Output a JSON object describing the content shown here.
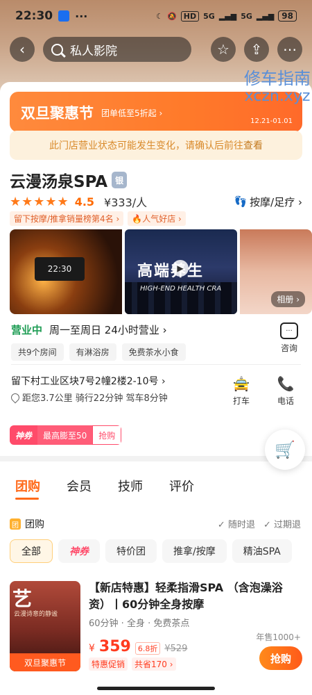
{
  "status_bar": {
    "time": "22:30",
    "dots": "···",
    "net_chip": "HD",
    "signal1": "5G",
    "signal2": "5G",
    "battery": "98"
  },
  "nav": {
    "back_icon": "back-arrow-icon",
    "search_text": "私人影院",
    "star_icon": "star-icon",
    "share_icon": "share-icon",
    "more_icon": "more-icon"
  },
  "watermark": {
    "line1": "修车指南",
    "line2": "xczn.xyz"
  },
  "promo": {
    "title": "双旦聚惠节",
    "subtitle": "团单低至5折起 ›",
    "dates": "12.21-01.01"
  },
  "notice": {
    "text": "此门店营业状态可能发生变化，请确认后前往",
    "link": "查看"
  },
  "store": {
    "name": "云漫汤泉SPA",
    "badge": "银",
    "stars": "★★★★★",
    "rating": "4.5",
    "price": "¥333/人",
    "category": "按摩/足疗 ›",
    "rank_tag": "留下按摩/推拿销量榜第4名 ›",
    "hot_tag": "🔥人气好店 ›"
  },
  "gallery": {
    "clock_text": "22:30",
    "video_title": "高端养生",
    "video_sub": "HIGH-END HEALTH CRA",
    "album_label": "相册 ›"
  },
  "hours": {
    "status": "营业中",
    "text": "周一至周日 24小时营业 ›",
    "consult_label": "咨询"
  },
  "facilities": [
    "共9个房间",
    "有淋浴房",
    "免费茶水小食"
  ],
  "address": {
    "line": "留下村工业区块7号2幢2楼2-10号 ›",
    "distance": "距您3.7公里 骑行22分钟 驾车8分钟",
    "taxi_label": "打车",
    "phone_label": "电话"
  },
  "coupon": {
    "brand": "神券",
    "text": "最高膨至50",
    "action": "抢购"
  },
  "tabs": [
    "团购",
    "会员",
    "技师",
    "评价"
  ],
  "group": {
    "icon_text": "团",
    "label": "团购",
    "g1": "随时退",
    "g2": "过期退"
  },
  "filters": [
    "全部",
    "神券",
    "特价团",
    "推拿/按摩",
    "精油SPA"
  ],
  "deal": {
    "img_char": "艺",
    "img_verse": "云漫诗意的静谧",
    "img_fest": "双旦聚惠节",
    "title": "【新店特惠】轻柔指滑SPA （含泡澡浴资）丨60分钟全身按摩",
    "meta": "60分钟 · 全身 · 免费茶点",
    "currency": "¥",
    "price": "359",
    "discount": "6.8折",
    "original": "¥529",
    "badge1": "特惠促销",
    "badge2": "共省170 ›",
    "sold": "年售1000+",
    "buy": "抢购"
  }
}
